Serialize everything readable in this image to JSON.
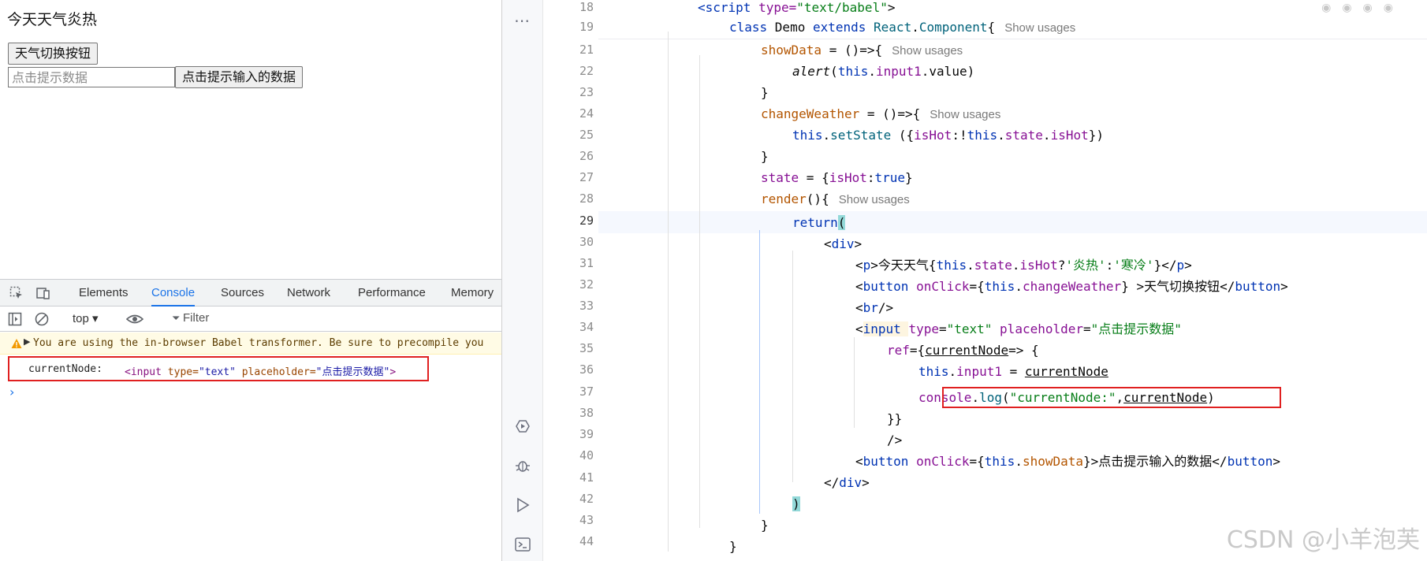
{
  "page": {
    "weather_text": "今天天气炎热",
    "switch_button": "天气切换按钮",
    "input_placeholder": "点击提示数据",
    "show_button": "点击提示输入的数据"
  },
  "devtools": {
    "tabs": [
      "Elements",
      "Console",
      "Sources",
      "Network",
      "Performance",
      "Memory"
    ],
    "active_tab": "Console",
    "context": "top ▾",
    "filter_placeholder": "Filter",
    "warning": "You are using the in-browser Babel transformer. Be sure to precompile you",
    "log_label": "currentNode:",
    "log_node": {
      "open": "<input ",
      "attr1": "type=",
      "val1": "\"text\"",
      "attr2": " placeholder=",
      "val2": "\"点击提示数据\"",
      "close": ">"
    },
    "prompt": "›"
  },
  "ide": {
    "hint": "Show usages",
    "watermark": "CSDN @小羊泡芙",
    "line_numbers": [
      "18",
      "19",
      "21",
      "22",
      "23",
      "24",
      "25",
      "26",
      "27",
      "28",
      "29",
      "30",
      "31",
      "32",
      "33",
      "34",
      "35",
      "36",
      "37",
      "38",
      "39",
      "40",
      "41",
      "42",
      "43",
      "44"
    ],
    "current_line": "29",
    "code": {
      "l18": [
        "<script ",
        "type=",
        "\"text/babel\"",
        ">"
      ],
      "l19": [
        "class ",
        "Demo ",
        "extends ",
        "React",
        ".",
        "Component",
        "{"
      ],
      "l21": [
        "showData",
        " = ()=>{"
      ],
      "l22": [
        "alert",
        "(",
        "this",
        ".",
        "input1",
        ".value)"
      ],
      "l23": [
        "}"
      ],
      "l24": [
        "changeWeather",
        " = ()=>{"
      ],
      "l25": [
        "this",
        ".",
        "setState",
        " ({",
        "isHot",
        ":!",
        "this",
        ".",
        "state",
        ".",
        "isHot",
        "})"
      ],
      "l26": [
        "}"
      ],
      "l27": [
        "state",
        " = {",
        "isHot",
        ":",
        "true",
        "}"
      ],
      "l28": [
        "render",
        "(){"
      ],
      "l29": [
        "return",
        "("
      ],
      "l30": [
        "<",
        "div",
        ">"
      ],
      "l31": [
        "<",
        "p",
        ">今天天气{",
        "this",
        ".",
        "state",
        ".",
        "isHot",
        "?",
        "'炎热'",
        ":",
        "'寒冷'",
        "}</",
        "p",
        ">"
      ],
      "l32": [
        "<",
        "button ",
        "onClick",
        "={",
        "this",
        ".",
        "changeWeather",
        "} >天气切换按钮</",
        "button",
        ">"
      ],
      "l33": [
        "<",
        "br",
        "/>"
      ],
      "l34": [
        "<",
        "input ",
        "type",
        "=",
        "\"text\" ",
        "placeholder",
        "=",
        "\"点击提示数据\""
      ],
      "l35": [
        "ref",
        "={",
        "currentNode",
        "=> {"
      ],
      "l36": [
        "this",
        ".",
        "input1",
        " = ",
        "currentNode"
      ],
      "l37": [
        "console",
        ".",
        "log",
        "(",
        "\"currentNode:\"",
        ",",
        "currentNode",
        ")"
      ],
      "l38": [
        "}}"
      ],
      "l39": [
        "/>"
      ],
      "l40": [
        "<",
        "button ",
        "onClick",
        "={",
        "this",
        ".",
        "showData",
        "}>点击提示输入的数据</",
        "button",
        ">"
      ],
      "l41": [
        "</",
        "div",
        ">"
      ],
      "l42": [
        ")"
      ],
      "l43": [
        "}"
      ],
      "l44": [
        "}"
      ]
    }
  }
}
